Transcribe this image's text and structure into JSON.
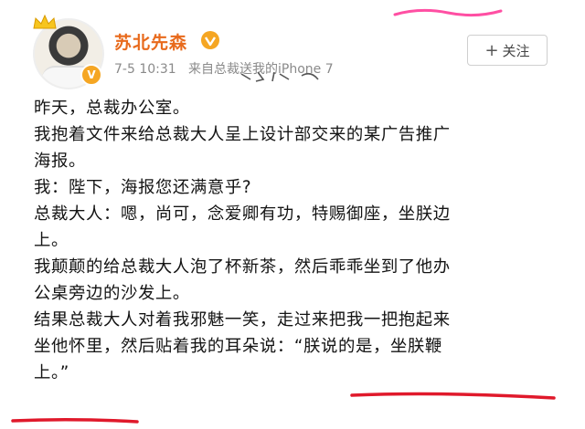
{
  "post": {
    "username": "苏北先森",
    "timestamp": "7-5 10:31",
    "source": "来自总裁送我的iPhone 7",
    "follow_label": "关注",
    "paragraphs": [
      "昨天，总裁办公室。",
      "我抱着文件来给总裁大人呈上设计部交来的某广告推广",
      "海报。",
      "我：陛下，海报您还满意乎?",
      "总裁大人：嗯，尚可，念爱卿有功，特赐御座，坐朕边",
      "上。",
      "我颠颠的给总裁大人泡了杯新茶，然后乖乖坐到了他办",
      "公桌旁边的沙发上。",
      "结果总裁大人对着我邪魅一笑，走过来把我一把抱起来",
      "坐他怀里，然后贴着我的耳朵说：“朕说的是，坐朕鞭",
      "上。”"
    ]
  },
  "colors": {
    "username": "#e86a1c",
    "verified_badge": "#f5a623",
    "underline": "#e0192b",
    "meta": "#8a8a8a"
  },
  "icons": {
    "avatar_crown": "crown-icon",
    "verified": "verified-badge-icon",
    "vip": "vip-icon",
    "follow_plus": "plus-icon"
  }
}
